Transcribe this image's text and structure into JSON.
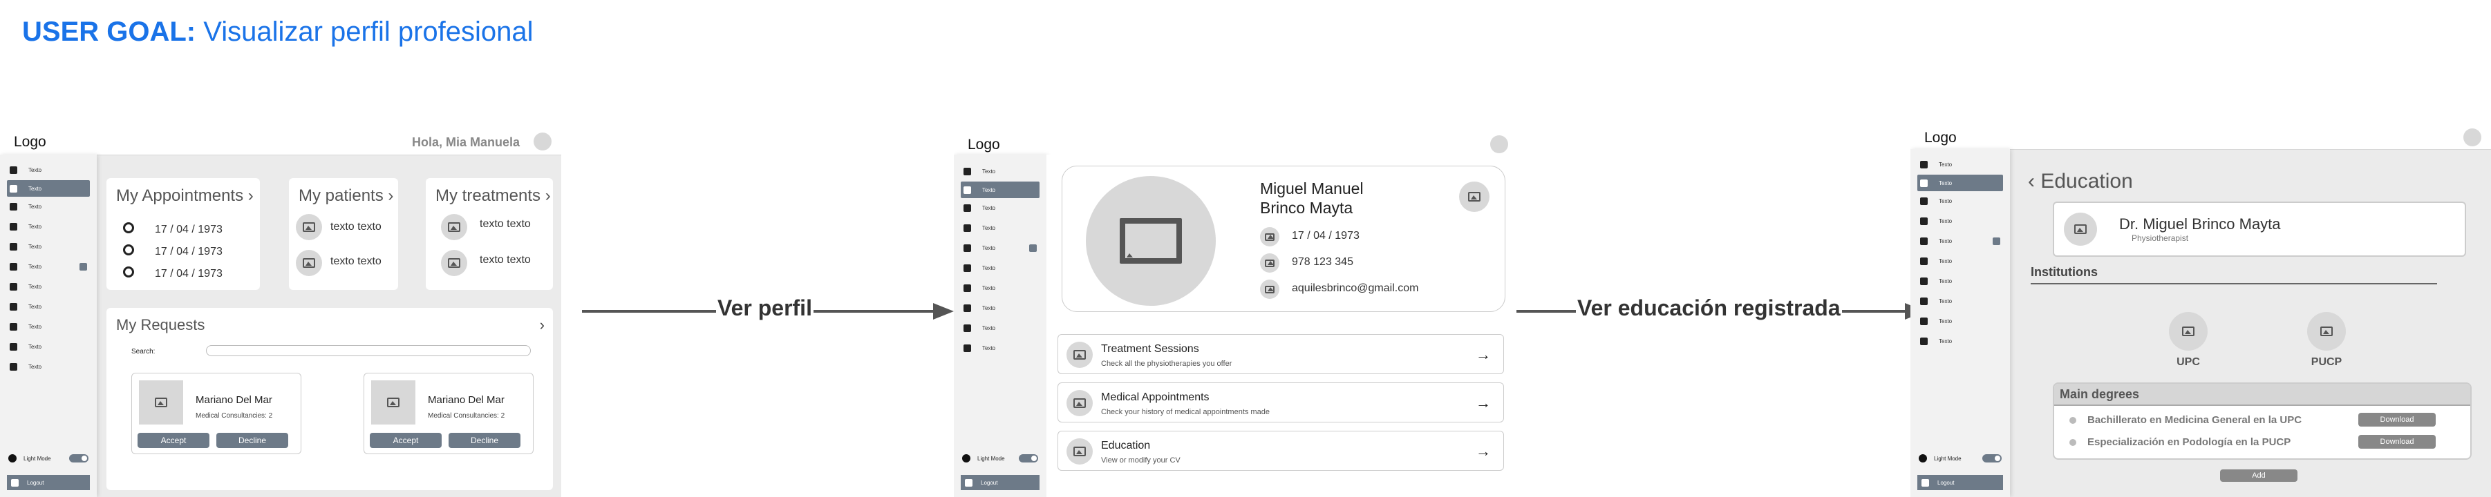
{
  "user_goal": {
    "label": "USER GOAL:",
    "text": "Visualizar perfil profesional"
  },
  "flows": [
    {
      "label": "Ver perfil"
    },
    {
      "label": "Ver educación registrada"
    }
  ],
  "sidebar": {
    "item_label": "Texto",
    "lightmode_label": "Light Mode",
    "logout_label": "Logout"
  },
  "screen1": {
    "logo": "Logo",
    "greeting": "Hola, Mia Manuela",
    "appointments": {
      "title": "My Appointments",
      "dates": [
        "17 / 04 / 1973",
        "17 / 04 / 1973",
        "17 / 04 / 1973"
      ]
    },
    "patients": {
      "title": "My patients",
      "items": [
        "texto texto",
        "texto texto"
      ]
    },
    "treatments": {
      "title": "My treatments",
      "items": [
        "texto texto",
        "texto texto"
      ]
    },
    "requests": {
      "title": "My Requests",
      "search_label": "Search:",
      "cards": [
        {
          "name": "Mariano Del Mar",
          "detail": "Medical Consultancies: 2",
          "accept": "Accept",
          "decline": "Decline"
        },
        {
          "name": "Mariano Del Mar",
          "detail": "Medical Consultancies: 2",
          "accept": "Accept",
          "decline": "Decline"
        }
      ]
    }
  },
  "screen2": {
    "logo": "Logo",
    "profile": {
      "name_line1": "Miguel Manuel",
      "name_line2": "Brinco Mayta",
      "birthdate": "17 / 04 / 1973",
      "phone": "978 123 345",
      "email": "aquilesbrinco@gmail.com"
    },
    "menu": [
      {
        "title": "Treatment Sessions",
        "subtitle": "Check all the physiotherapies you offer"
      },
      {
        "title": "Medical Appointments",
        "subtitle": "Check your history of medical appointments made"
      },
      {
        "title": "Education",
        "subtitle": "View or modify your CV"
      }
    ]
  },
  "screen3": {
    "logo": "Logo",
    "title": "Education",
    "doctor_name": "Dr. Miguel Brinco Mayta",
    "doctor_role": "Physiotherapist",
    "institutions_label": "Institutions",
    "institutions": [
      "UPC",
      "PUCP"
    ],
    "main_degrees_label": "Main degrees",
    "degrees": [
      {
        "name": "Bachillerato en Medicina General en la UPC",
        "action": "Download"
      },
      {
        "name": "Especialización en Podología en la PUCP",
        "action": "Download"
      }
    ],
    "add_label": "Add"
  }
}
